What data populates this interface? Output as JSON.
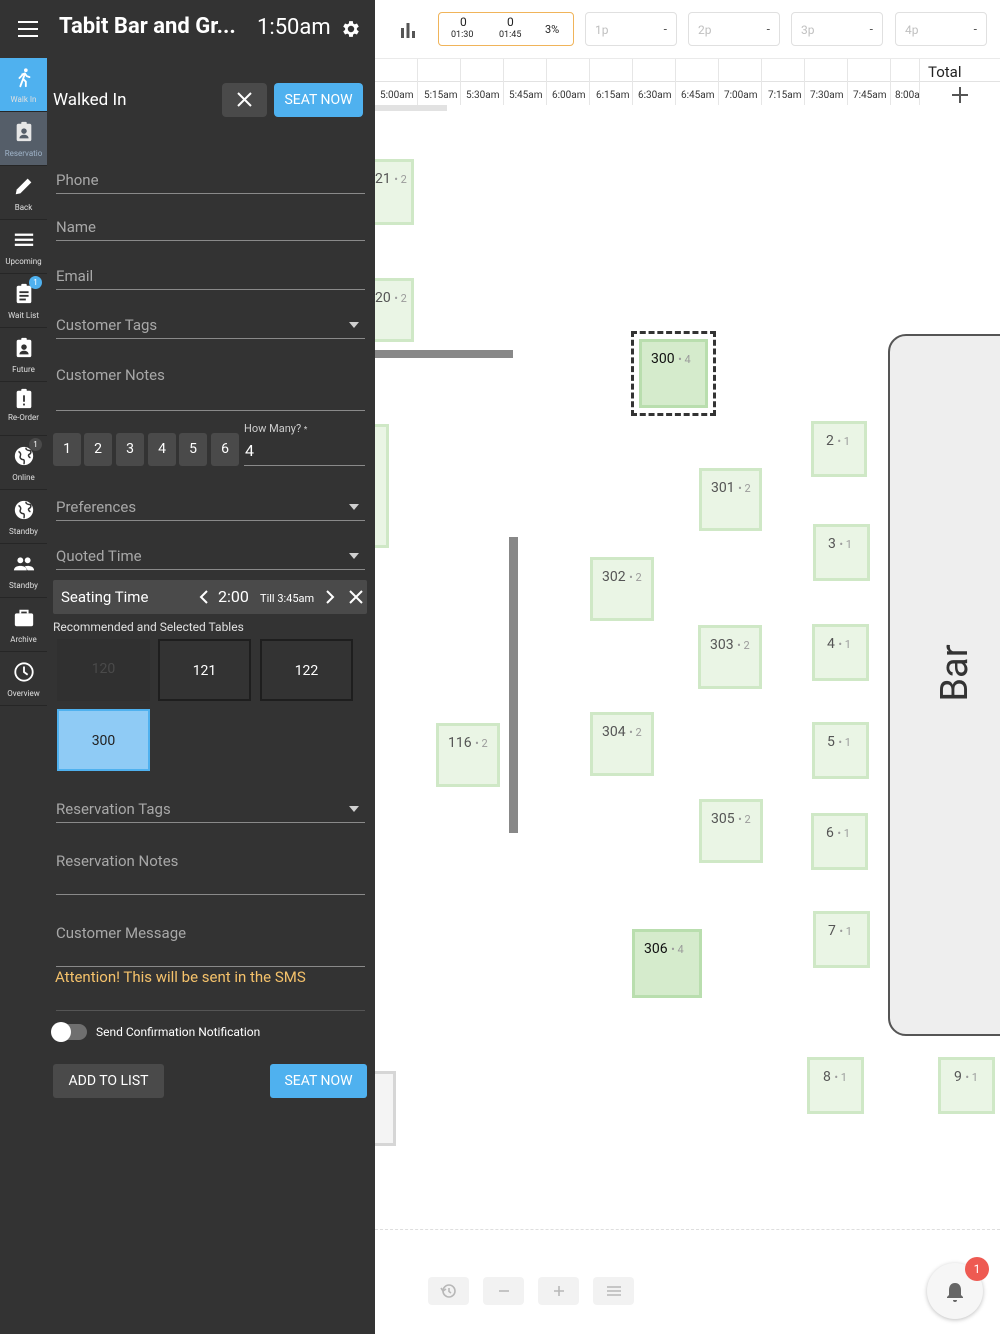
{
  "header": {
    "venue": "Tabit Bar and Gr...",
    "time": "1:50am"
  },
  "rail": [
    {
      "label": "Walk In",
      "icon": "walk-icon"
    },
    {
      "label": "Reservatio",
      "icon": "clipboard-user-icon"
    },
    {
      "label": "Back",
      "icon": "pencil-icon"
    },
    {
      "label": "Upcoming",
      "icon": "list-icon"
    },
    {
      "label": "Wait List",
      "icon": "clipboard-list-icon",
      "badge": "1"
    },
    {
      "label": "Future",
      "icon": "clipboard-icon"
    },
    {
      "label": "Re-Order",
      "icon": "clipboard-alert-icon"
    },
    {
      "label": "Online",
      "icon": "globe-icon",
      "badge": "1"
    },
    {
      "label": "Standby",
      "icon": "globe-icon"
    },
    {
      "label": "Standby",
      "icon": "group-icon"
    },
    {
      "label": "Archive",
      "icon": "briefcase-icon"
    },
    {
      "label": "Overview",
      "icon": "clock-icon"
    }
  ],
  "panel": {
    "title": "Walked In",
    "seat_now": "SEAT NOW",
    "fields": {
      "phone": "Phone",
      "name": "Name",
      "email": "Email",
      "customer_tags": "Customer Tags",
      "customer_notes": "Customer Notes",
      "preferences": "Preferences",
      "quoted_time": "Quoted Time",
      "reservation_tags": "Reservation Tags",
      "reservation_notes": "Reservation Notes",
      "customer_message": "Customer Message"
    },
    "party_sizes": [
      "1",
      "2",
      "3",
      "4",
      "5",
      "6"
    ],
    "how_many_label": "How Many?",
    "how_many_required": "*",
    "how_many_value": "4",
    "seating": {
      "label": "Seating Time",
      "value": "2:00",
      "till": "Till 3:45am"
    },
    "recommended_label": "Recommended and Selected Tables",
    "recommended_tables": [
      {
        "label": "120",
        "state": "disabled"
      },
      {
        "label": "121",
        "state": "available"
      },
      {
        "label": "122",
        "state": "available"
      },
      {
        "label": "300",
        "state": "selected"
      }
    ],
    "attention": "Attention! This will be sent in the SMS",
    "send_confirmation": "Send Confirmation Notification",
    "send_confirmation_on": false,
    "add_to_list": "ADD TO LIST",
    "seat_now_bottom": "SEAT NOW"
  },
  "stats": {
    "a_count": "0",
    "a_time": "01:30",
    "b_count": "0",
    "b_time": "01:45",
    "percent": "3%"
  },
  "courses": [
    {
      "label": "1p",
      "value": "-"
    },
    {
      "label": "2p",
      "value": "-"
    },
    {
      "label": "3p",
      "value": "-"
    },
    {
      "label": "4p",
      "value": "-"
    }
  ],
  "timeline": {
    "total": "Total",
    "slots": [
      "5:00am",
      "5:15am",
      "5:30am",
      "5:45am",
      "6:00am",
      "6:15am",
      "6:30am",
      "6:45am",
      "7:00am",
      "7:15am",
      "7:30am",
      "7:45am",
      "8:00a"
    ]
  },
  "floor": {
    "bar_label": "Bar",
    "tables": [
      {
        "id": "21",
        "cap": "2"
      },
      {
        "id": "20",
        "cap": "2"
      },
      {
        "id": "300",
        "cap": "4",
        "selected": true
      },
      {
        "id": "2",
        "cap": "1"
      },
      {
        "id": "301",
        "cap": "2"
      },
      {
        "id": "3",
        "cap": "1"
      },
      {
        "id": "302",
        "cap": "2"
      },
      {
        "id": "303",
        "cap": "2"
      },
      {
        "id": "4",
        "cap": "1"
      },
      {
        "id": "116",
        "cap": "2"
      },
      {
        "id": "304",
        "cap": "2"
      },
      {
        "id": "5",
        "cap": "1"
      },
      {
        "id": "305",
        "cap": "2"
      },
      {
        "id": "6",
        "cap": "1"
      },
      {
        "id": "306",
        "cap": "4"
      },
      {
        "id": "7",
        "cap": "1"
      },
      {
        "id": "8",
        "cap": "1"
      },
      {
        "id": "9",
        "cap": "1"
      }
    ]
  },
  "notifications": {
    "count": "1"
  },
  "colors": {
    "accent": "#4fb1ef",
    "panel": "#333333",
    "table": "#eaf5e5",
    "table_border": "#cfe8c6",
    "warning": "#f5c26b",
    "badge": "#ee5a52"
  }
}
